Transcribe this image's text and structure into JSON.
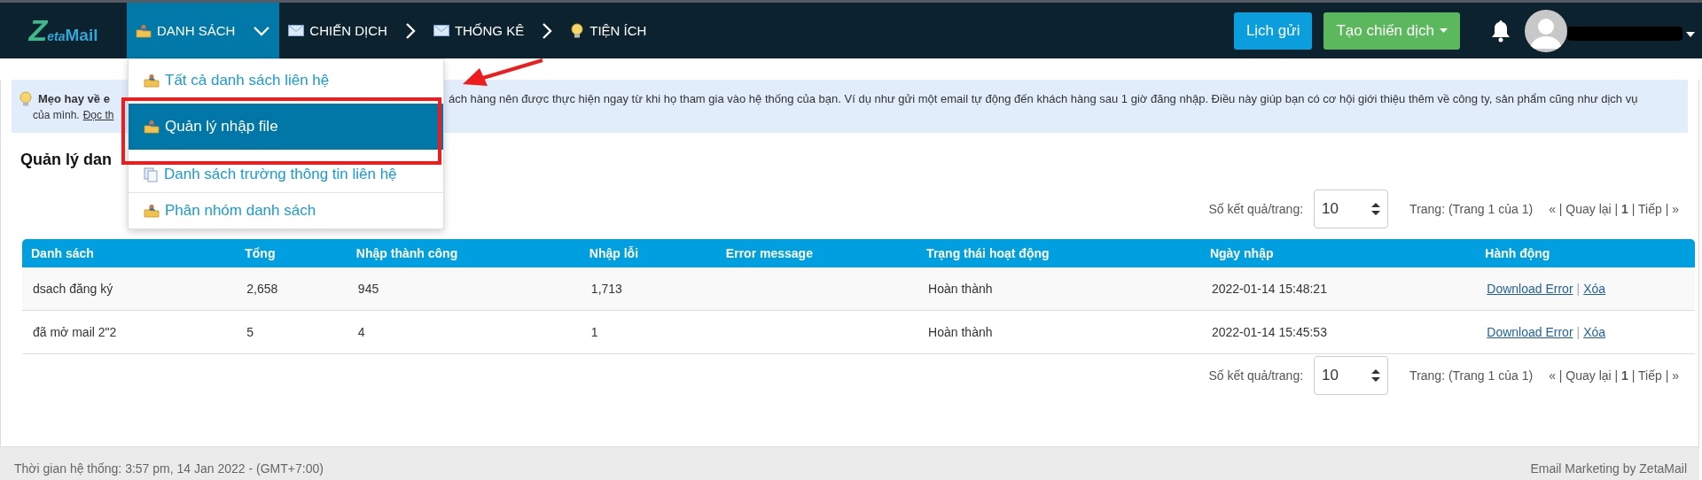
{
  "logo": {
    "parts": [
      "Z",
      "eta",
      "Mail"
    ]
  },
  "nav": {
    "items": [
      {
        "label": "DANH SÁCH",
        "kind": "folder",
        "selected": true,
        "expanded": true
      },
      {
        "label": "CHIẾN DỊCH",
        "kind": "mail",
        "selected": false,
        "expanded": false
      },
      {
        "label": "THỐNG KÊ",
        "kind": "mail",
        "selected": false,
        "expanded": false
      },
      {
        "label": "TIỆN ÍCH",
        "kind": "tool",
        "selected": false
      }
    ],
    "schedule_button": "Lịch gửi",
    "create_button": "Tạo chiến dịch"
  },
  "dropdown": {
    "items": [
      {
        "label": "Tất cả danh sách liên hệ",
        "kind": "list",
        "selected": false
      },
      {
        "label": "Quản lý nhập file",
        "kind": "list",
        "selected": true
      },
      {
        "label": "Danh sách trường thông tin liên hệ",
        "kind": "fields",
        "selected": false
      },
      {
        "label": "Phân nhóm danh sách",
        "kind": "list",
        "selected": false
      }
    ]
  },
  "tip": {
    "title": "Mẹo hay về e",
    "text": "ách hàng nên được thực hiện ngay từ khi họ tham gia vào hệ thống của bạn. Ví dụ như gửi một email tự động đến khách hàng sau 1 giờ đăng nhập. Điều này giúp bạn có cơ hội giới thiệu thêm về công ty, sản phẩm cũng như dịch vụ",
    "line2": "của mình.",
    "link": "Đọc th"
  },
  "heading": "Quản lý dan",
  "pagers": [
    {
      "per_page_label": "Số kết quả/trang:",
      "per_page": "10",
      "page_info": "Trang: (Trang 1 của 1)",
      "links": "« | Quay lại | **1** | Tiếp | »"
    },
    {
      "per_page_label": "Số kết quả/trang:",
      "per_page": "10",
      "page_info": "Trang: (Trang 1 của 1)",
      "links": "« | Quay lại | **1** | Tiếp | »"
    }
  ],
  "table": {
    "columns": [
      "Danh sách",
      "Tổng",
      "Nhập thành công",
      "Nhập lỗi",
      "Error message",
      "Trạng thái hoạt động",
      "Ngày nhập",
      "Hành động"
    ],
    "action_separator": "|",
    "rows": [
      {
        "name": "dsach đăng ký",
        "total": "2,658",
        "success": "945",
        "errors": "1,713",
        "status": "Hoàn thành",
        "date": "2022-01-14 15:48:21",
        "actions": [
          "Download Error",
          "Xóa"
        ]
      },
      {
        "name": "đã mở mail 2\"2",
        "total": "5",
        "success": "4",
        "errors": "1",
        "status": "Hoàn thành",
        "date": "2022-01-14 15:45:53",
        "actions": [
          "Download Error",
          "Xóa"
        ]
      }
    ]
  },
  "footer": {
    "left": "Thời gian hệ thống: 3:57 pm, 14 Jan 2022 - (GMT+7:00)",
    "right": "Email Marketing by ZetaMail"
  }
}
